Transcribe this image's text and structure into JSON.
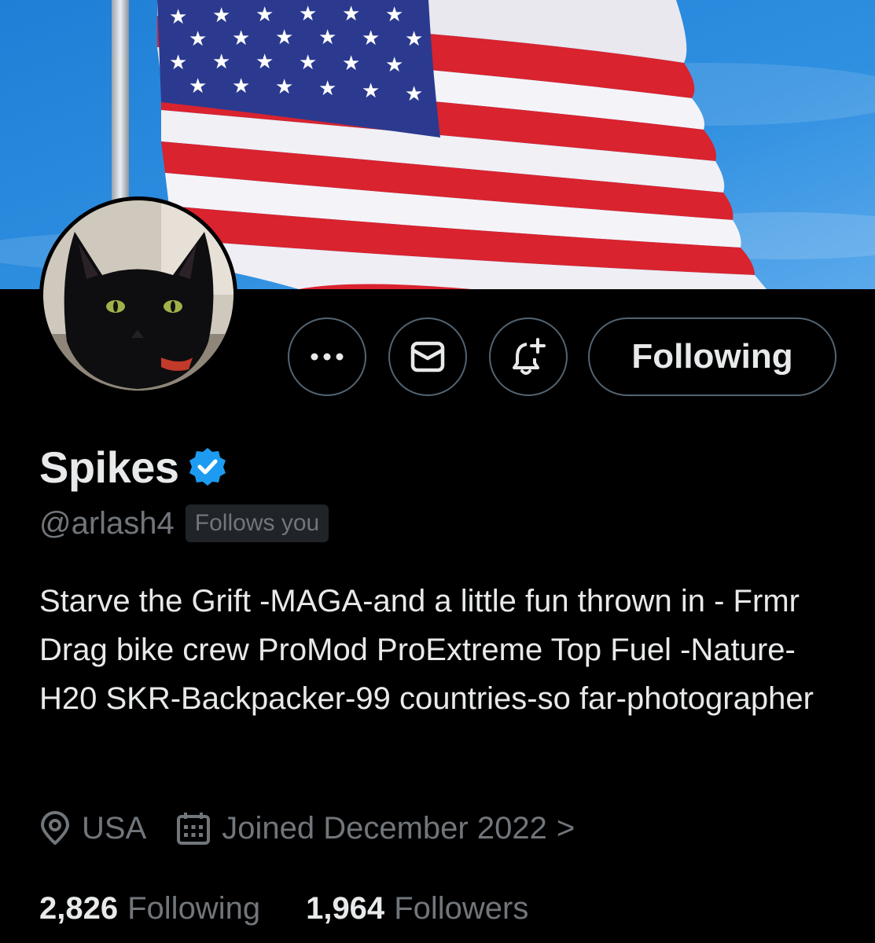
{
  "profile": {
    "display_name": "Spikes",
    "handle": "@arlash4",
    "follows_you_badge": "Follows you",
    "bio": "Starve the Grift -MAGA-and a little fun thrown in - Frmr Drag bike crew ProMod ProExtreme Top Fuel -Nature-H20 SKR-Backpacker-99 countries-so far-photographer",
    "location": "USA",
    "joined": "Joined December 2022",
    "joined_chevron": ">"
  },
  "stats": {
    "following_count": "2,826",
    "following_label": "Following",
    "followers_count": "1,964",
    "followers_label": "Followers"
  },
  "actions": {
    "more_label": "•••",
    "following_button_label": "Following"
  },
  "icons": {
    "more": "more-horizontal-icon",
    "message": "envelope-icon",
    "notify": "bell-plus-icon",
    "verified": "verified-badge-icon",
    "location": "location-pin-icon",
    "calendar": "calendar-icon"
  },
  "colors": {
    "background": "#000000",
    "primary_text": "#e7e9ea",
    "secondary_text": "#71767b",
    "border": "#536471",
    "verified_blue": "#1d9bf0",
    "badge_bg": "#202327"
  }
}
